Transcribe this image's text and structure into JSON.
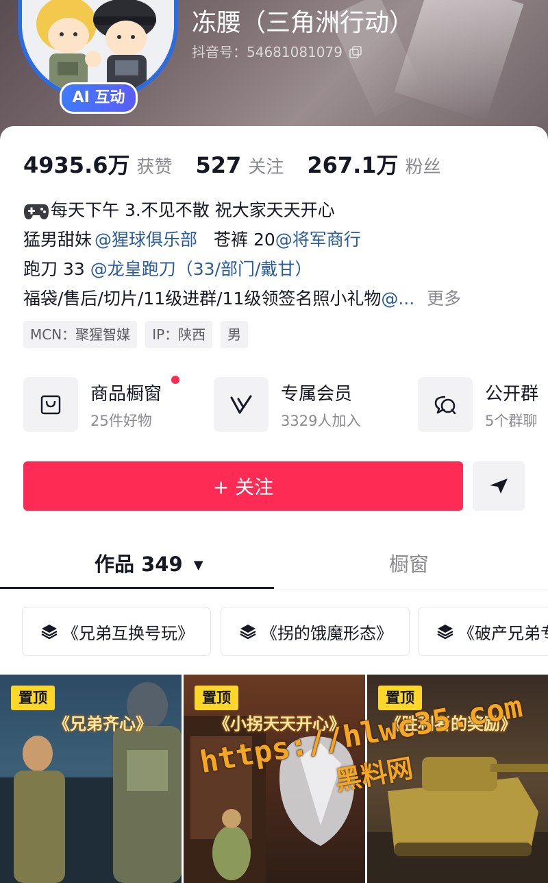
{
  "profile": {
    "name": "冻腰（三角洲行动）",
    "douyin_id": "抖音号：54681081079",
    "ai_badge": "AI 互动"
  },
  "stats": [
    {
      "value": "4935.6万",
      "label": "获赞"
    },
    {
      "value": "527",
      "label": "关注"
    },
    {
      "value": "267.1万",
      "label": "粉丝"
    }
  ],
  "bio": {
    "line1": "每天下午 3.不见不散 祝大家天天开心",
    "line2_text1": "猛男甜妹",
    "line2_link1": "@猩球俱乐部",
    "line2_text2": "苍裤 20",
    "line2_link2": "@将军商行",
    "line3_text1": "跑刀 33 ",
    "line3_link1": "@龙皇跑刀（33/部门/戴甘）",
    "line4_text": "福袋/售后/切片/11级进群/11级领签名照小礼物",
    "line4_link": "@...",
    "more": "更多"
  },
  "tags": [
    "MCN：聚猩智媒",
    "IP：陕西",
    "男"
  ],
  "features": [
    {
      "title": "商品橱窗",
      "sub": "25件好物",
      "icon": "shop-bag-icon"
    },
    {
      "title": "专属会员",
      "sub": "3329人加入",
      "icon": "vip-v-icon"
    },
    {
      "title": "公开群",
      "sub": "5个群聊",
      "icon": "group-chat-icon"
    }
  ],
  "actions": {
    "follow": "+ 关注",
    "send_icon": "send-icon"
  },
  "tabs": {
    "works": "作品 349",
    "works_arrow": "▼",
    "shop": "橱窗"
  },
  "collections": [
    "《兄弟互换号玩》",
    "《拐的饿魔形态》",
    "《破产兄弟专"
  ],
  "videos": [
    {
      "pin": "置顶",
      "caption": "《兄弟齐心》"
    },
    {
      "pin": "置顶",
      "caption": "《小拐天天开心》"
    },
    {
      "pin": "置顶",
      "caption": "《胜利者的奖励》"
    }
  ],
  "watermark": {
    "url": "https://hlwc35.com",
    "name": "黑料网"
  },
  "colors": {
    "accent": "#fe2c55",
    "link": "#2a5b9c",
    "pin": "#fcd628",
    "badge": "#3e7bff"
  }
}
